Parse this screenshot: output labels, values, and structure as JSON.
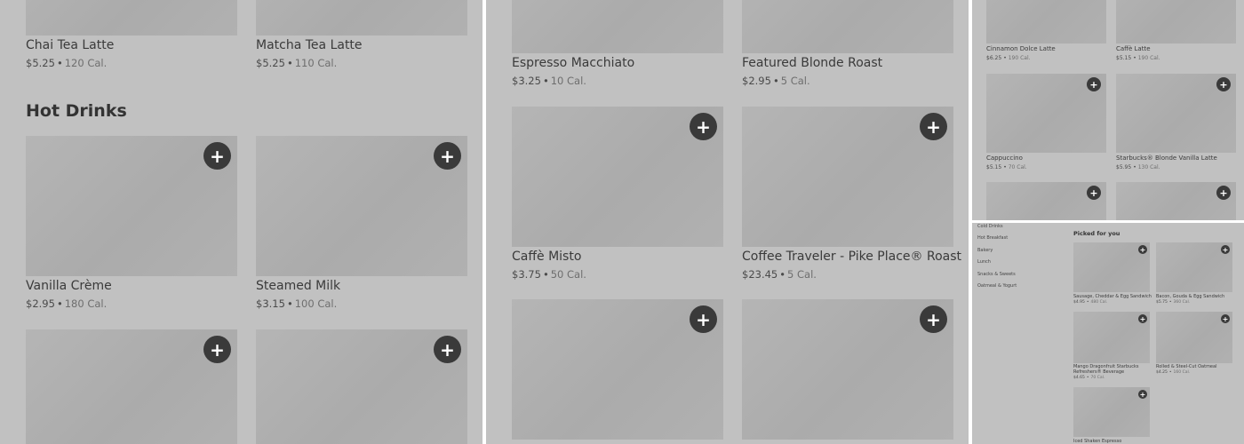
{
  "panel_1": {
    "top_items": [
      {
        "name": "Chai Tea Latte",
        "price": "$5.25",
        "calories": "120 Cal."
      },
      {
        "name": "Matcha Tea Latte",
        "price": "$5.25",
        "calories": "110 Cal."
      }
    ],
    "section_title": "Hot Drinks",
    "items": [
      {
        "name": "Vanilla Crème",
        "price": "$2.95",
        "calories": "180 Cal."
      },
      {
        "name": "Steamed Milk",
        "price": "$3.15",
        "calories": "100 Cal."
      }
    ],
    "add_label": "+",
    "separator": "•"
  },
  "panel_2": {
    "top_items": [
      {
        "name": "Espresso Macchiato",
        "price": "$3.25",
        "calories": "10 Cal."
      },
      {
        "name": "Featured Blonde Roast",
        "price": "$2.95",
        "calories": "5 Cal."
      }
    ],
    "items": [
      {
        "name": "Caffè Misto",
        "price": "$3.75",
        "calories": "50 Cal."
      },
      {
        "name": "Coffee Traveler - Pike Place® Roast",
        "price": "$23.45",
        "calories": "5 Cal."
      }
    ]
  },
  "panel_3": {
    "top_items": [
      {
        "name": "Cinnamon Dolce Latte",
        "price": "$6.25",
        "calories": "190 Cal."
      },
      {
        "name": "Caffè Latte",
        "price": "$5.15",
        "calories": "190 Cal."
      }
    ],
    "items": [
      {
        "name": "Cappuccino",
        "price": "$5.15",
        "calories": "70 Cal."
      },
      {
        "name": "Starbucks® Blonde Vanilla Latte",
        "price": "$5.95",
        "calories": "130 Cal."
      }
    ]
  },
  "panel_4": {
    "nav": [
      "Cold Drinks",
      "Hot Breakfast",
      "Bakery",
      "Lunch",
      "Snacks & Sweets",
      "Oatmeal & Yogurt"
    ],
    "section_title": "Picked for you",
    "items": [
      {
        "name": "Sausage, Cheddar & Egg Sandwich",
        "price": "$4.95",
        "calories": "480 Cal."
      },
      {
        "name": "Bacon, Gouda & Egg Sandwich",
        "price": "$5.75",
        "calories": "360 Cal."
      },
      {
        "name": "Mango Dragonfruit Starbucks",
        "name2": "Refreshers® Beverage",
        "price": "$4.65",
        "calories": "70 Cal."
      },
      {
        "name": "Rolled & Steel-Cut Oatmeal",
        "price": "$4.25",
        "calories": "160 Cal."
      },
      {
        "name": "Iced Shaken Espresso"
      }
    ]
  }
}
